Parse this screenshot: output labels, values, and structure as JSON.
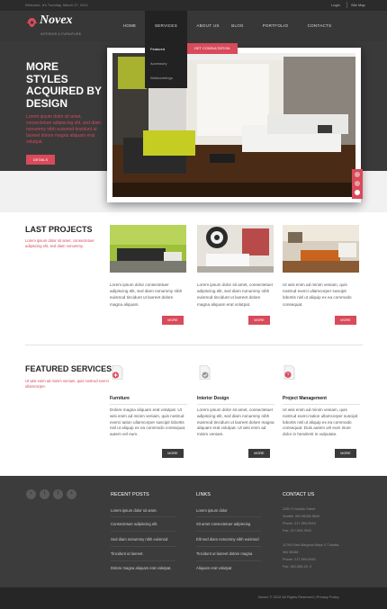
{
  "topbar": {
    "welcome": "Welcome, It's Tuesday, March 27, 2012",
    "login": "Login",
    "sitemap": "Site Map"
  },
  "logo": {
    "name": "Novex",
    "tagline": "INTERIOR & FURNITURE"
  },
  "nav": [
    "HOME",
    "SERVICES",
    "ABOUT US",
    "BLOG",
    "PORTFOLIO",
    "CONTACTS"
  ],
  "dropdown": [
    "Featured",
    "Accessory",
    "Wallcoverings"
  ],
  "hero": {
    "title": "MORE STYLES ACQUIRED BY DESIGN",
    "text": "Lorem ipsum dolor sit amet, consectetuer adipiscing elit, sed diam nonummy nibh euismod tincidunt ut laoreet dolore magna aliquam erat volutpat.",
    "button": "DETAILS",
    "slider_tag": "GET CONSULTATION"
  },
  "projects": {
    "title": "LAST PROJECTS",
    "subtitle": "Lorem ipsum dolor sit amet, consectetuer adipiscing elit, sed diam nonummy.",
    "items": [
      {
        "text": "Lorem ipsum dolor consectetuer adipiscing elit, sed diam nonummy nibh euismod tincidunt ut laoreet dolore magna aliquam.",
        "button": "MORE"
      },
      {
        "text": "Lorem ipsum dolor sit amet, consectetuer adipiscing elit, sed diam nonummy nibh euismod tincidunt ut laoreet dolore magna aliquam erat volutpat.",
        "button": "MORE"
      },
      {
        "text": "Ut wisi enim ad minim veniam, quis nostrud exerci ullamcorper suscipit lobortis nisl ut aliquip ex ea commodo consequat.",
        "button": "MORE"
      }
    ]
  },
  "featured": {
    "title": "FEATURED SERVICES",
    "subtitle": "Ut wisi enim ad minim veniam, quis nostrud exerci ullamcorper.",
    "items": [
      {
        "title": "Furniture",
        "text": "Dolore magna aliquam erat volutpat. Ut wisi enim ad minim veniam, quis nostrud exerci tation ullamcorper suscipit lobortis nisl ut aliquip ex ea commodo consequat. autem vel eum.",
        "button": "MORE"
      },
      {
        "title": "Interior Design",
        "text": "Lorem ipsum dolor sit amet, consectetuer adipiscing elit, sed diam nonummy nibh euismod tincidunt ut laoreet dolore magna aliquam erat volutpat. Ut wisi enim ad minim veniam.",
        "button": "MORE"
      },
      {
        "title": "Project Management",
        "text": "Ut wisi enim ad minim veniam, quis nostrud exerci tation ullamcorper suscipit lobortis nisl ut aliquip ex ea commodo consequat. Duis autem vel eum iriure dolor in hendrerit in vulputate.",
        "button": "MORE"
      }
    ]
  },
  "footer": {
    "social": [
      "rss",
      "twitter",
      "facebook",
      "plus"
    ],
    "recent_title": "RECENT POSTS",
    "recent": [
      "Lorem ipsum dolor sit amet.",
      "Consectetuer adipiscing elit.",
      "Sed diam nonummy nibh euismod.",
      "Tincidunt ut laoreet.",
      "Dolore magna aliquam erat volutpat."
    ],
    "links_title": "LINKS",
    "links": [
      "Lorem ipsum dolor",
      "Sit amet consectetuer adipiscing",
      "Elit sed diam nonummy nibh euismod",
      "Tincidunt ut laoreet dolore magna",
      "Aliquam erat volutpat"
    ],
    "contact_title": "CONTACT US",
    "contact1": [
      "2250 S Norfolk Street",
      "Seattle, WA 98108-5640",
      "Phone: 217-594-9943",
      "Fax: 217-594-9942"
    ],
    "contact2": [
      "11794 East Marginal Ways S Tukwila,",
      "WA 98168",
      "Phone: 217-594-9942",
      "Fax: 360-558-20..3"
    ],
    "copyright": "Novex © 2012 All Rights Reserved  |  Privacy Policy"
  },
  "colors": {
    "accent": "#d94a5a",
    "dark": "#373737"
  }
}
